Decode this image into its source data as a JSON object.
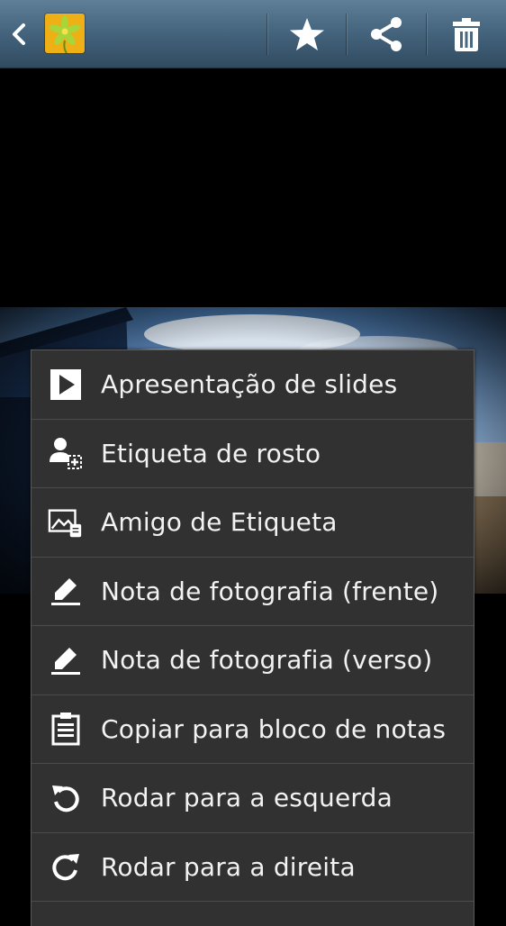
{
  "actionbar": {
    "back_icon": "chevron-left-icon",
    "app_icon": "gallery-flower-icon",
    "actions": [
      {
        "name": "favorite",
        "icon": "star-icon"
      },
      {
        "name": "share",
        "icon": "share-icon"
      },
      {
        "name": "delete",
        "icon": "trash-icon"
      }
    ]
  },
  "menu": {
    "items": [
      {
        "label": "Apresentação de slides",
        "icon": "play-icon"
      },
      {
        "label": "Etiqueta de rosto",
        "icon": "face-tag-icon"
      },
      {
        "label": "Amigo de Etiqueta",
        "icon": "buddy-tag-icon"
      },
      {
        "label": "Nota de fotografia (frente)",
        "icon": "pen-icon"
      },
      {
        "label": "Nota de fotografia (verso)",
        "icon": "pen-icon"
      },
      {
        "label": "Copiar para bloco de notas",
        "icon": "clipboard-icon"
      },
      {
        "label": "Rodar para a esquerda",
        "icon": "rotate-left-icon"
      },
      {
        "label": "Rodar para a direita",
        "icon": "rotate-right-icon"
      }
    ]
  },
  "colors": {
    "actionbar_top": "#5f7f98",
    "actionbar_bottom": "#2f4b61",
    "menu_bg": "#313131",
    "menu_divider": "#4b4b4b",
    "menu_text": "#f2f2f2"
  }
}
